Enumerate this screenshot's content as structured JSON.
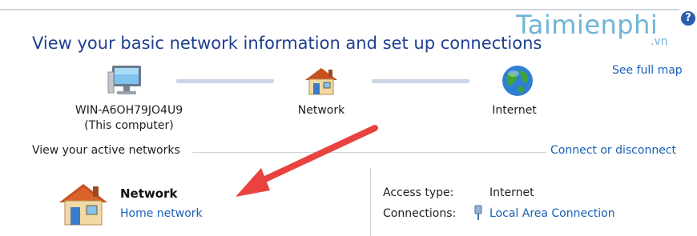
{
  "header": {
    "title": "View your basic network information and set up connections",
    "help_symbol": "?",
    "watermark": "Taimienphi",
    "watermark_sub": ".vn",
    "see_full_map": "See full map"
  },
  "map": {
    "computer": {
      "name": "WIN-A6OH79JO4U9",
      "subtitle": "(This computer)",
      "icon": "computer-icon"
    },
    "network": {
      "name": "Network",
      "icon": "house-icon"
    },
    "internet": {
      "name": "Internet",
      "icon": "globe-icon"
    }
  },
  "active": {
    "section_label": "View your active networks",
    "connect_link": "Connect or disconnect",
    "network_name": "Network",
    "network_type": "Home network",
    "access_type_label": "Access type:",
    "access_type_value": "Internet",
    "connections_label": "Connections:",
    "connections_value": "Local Area Connection"
  },
  "colors": {
    "title": "#1f3f8f",
    "link": "#1a5fb8",
    "arrow": "#e8433f"
  }
}
